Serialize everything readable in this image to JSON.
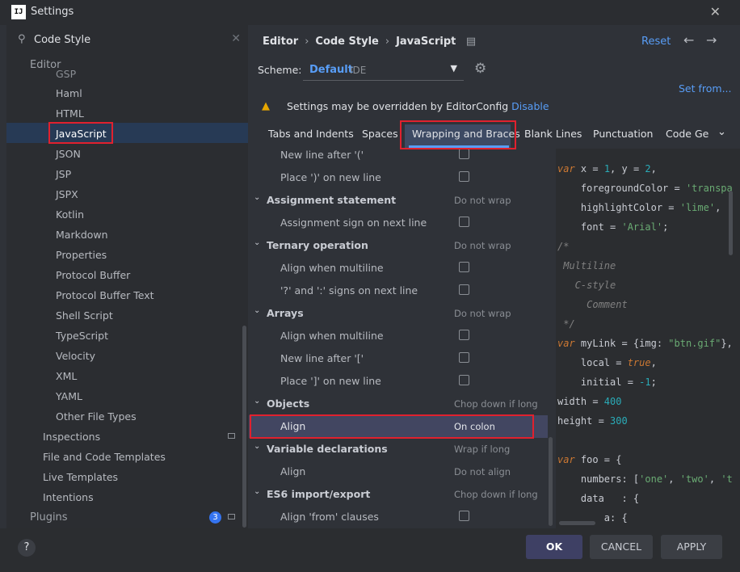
{
  "window": {
    "title": "Settings",
    "app_icon": "IJ"
  },
  "search": {
    "value": "Code Style"
  },
  "sidebar": {
    "section_editor": "Editor",
    "items": [
      "GSP",
      "Haml",
      "HTML",
      "JavaScript",
      "JSON",
      "JSP",
      "JSPX",
      "Kotlin",
      "Markdown",
      "Properties",
      "Protocol Buffer",
      "Protocol Buffer Text",
      "Shell Script",
      "TypeScript",
      "Velocity",
      "XML",
      "YAML",
      "Other File Types"
    ],
    "selected": "JavaScript",
    "editor_children": [
      "Inspections",
      "File and Code Templates",
      "Live Templates",
      "Intentions"
    ],
    "section_plugins": "Plugins",
    "plugins_badge": "3"
  },
  "breadcrumb": {
    "editor": "Editor",
    "code_style": "Code Style",
    "javascript": "JavaScript",
    "sep": "›"
  },
  "header": {
    "reset": "Reset"
  },
  "scheme": {
    "label": "Scheme:",
    "name": "Default",
    "type": "IDE"
  },
  "set_from": "Set from...",
  "warning": {
    "text": "Settings may be overridden by EditorConfig",
    "link": "Disable"
  },
  "tabs": [
    "Tabs and Indents",
    "Spaces",
    "Wrapping and Braces",
    "Blank Lines",
    "Punctuation",
    "Code Ge"
  ],
  "active_tab": "Wrapping and Braces",
  "options": [
    {
      "label": "New line after '('",
      "kind": "check"
    },
    {
      "label": "Place ')' on new line",
      "kind": "check"
    },
    {
      "label": "Assignment statement",
      "kind": "group",
      "value": "Do not wrap"
    },
    {
      "label": "Assignment sign on next line",
      "kind": "check"
    },
    {
      "label": "Ternary operation",
      "kind": "group",
      "value": "Do not wrap"
    },
    {
      "label": "Align when multiline",
      "kind": "check"
    },
    {
      "label": "'?' and ':' signs on next line",
      "kind": "check"
    },
    {
      "label": "Arrays",
      "kind": "group",
      "value": "Do not wrap"
    },
    {
      "label": "Align when multiline",
      "kind": "check"
    },
    {
      "label": "New line after '['",
      "kind": "check"
    },
    {
      "label": "Place ']' on new line",
      "kind": "check"
    },
    {
      "label": "Objects",
      "kind": "group",
      "value": "Chop down if long"
    },
    {
      "label": "Align",
      "kind": "value",
      "value": "On colon",
      "highlight": true
    },
    {
      "label": "Variable declarations",
      "kind": "group",
      "value": "Wrap if long"
    },
    {
      "label": "Align",
      "kind": "value",
      "value": "Do not align"
    },
    {
      "label": "ES6 import/export",
      "kind": "group",
      "value": "Chop down if long"
    },
    {
      "label": "Align 'from' clauses",
      "kind": "check"
    }
  ],
  "preview": [
    {
      "t": "empty"
    },
    {
      "t": "code",
      "parts": [
        [
          "kw",
          "var"
        ],
        [
          "p",
          " x = "
        ],
        [
          "num",
          "1"
        ],
        [
          "p",
          ", y = "
        ],
        [
          "num",
          "2"
        ],
        [
          "p",
          ","
        ]
      ]
    },
    {
      "t": "code",
      "parts": [
        [
          "p",
          "    foregroundColor = "
        ],
        [
          "str",
          "'transpa"
        ]
      ]
    },
    {
      "t": "code",
      "parts": [
        [
          "p",
          "    highlightColor = "
        ],
        [
          "str",
          "'lime'"
        ],
        [
          "p",
          ","
        ]
      ]
    },
    {
      "t": "code",
      "parts": [
        [
          "p",
          "    font = "
        ],
        [
          "str",
          "'Arial'"
        ],
        [
          "p",
          ";"
        ]
      ]
    },
    {
      "t": "code",
      "parts": [
        [
          "cmt",
          "/*"
        ]
      ]
    },
    {
      "t": "code",
      "parts": [
        [
          "cmt",
          " Multiline"
        ]
      ]
    },
    {
      "t": "code",
      "parts": [
        [
          "cmt",
          "   C-style"
        ]
      ]
    },
    {
      "t": "code",
      "parts": [
        [
          "cmt",
          "     Comment"
        ]
      ]
    },
    {
      "t": "code",
      "parts": [
        [
          "cmt",
          " */"
        ]
      ]
    },
    {
      "t": "code",
      "parts": [
        [
          "kw",
          "var"
        ],
        [
          "p",
          " myLink = {img: "
        ],
        [
          "str",
          "\"btn.gif\""
        ],
        [
          "p",
          "},"
        ]
      ]
    },
    {
      "t": "code",
      "parts": [
        [
          "p",
          "    local = "
        ],
        [
          "kw",
          "true"
        ],
        [
          "p",
          ","
        ]
      ]
    },
    {
      "t": "code",
      "parts": [
        [
          "p",
          "    initial = "
        ],
        [
          "num",
          "-1"
        ],
        [
          "p",
          ";"
        ]
      ]
    },
    {
      "t": "code",
      "parts": [
        [
          "p",
          "width = "
        ],
        [
          "num",
          "400"
        ]
      ]
    },
    {
      "t": "code",
      "parts": [
        [
          "p",
          "height = "
        ],
        [
          "num",
          "300"
        ]
      ]
    },
    {
      "t": "empty"
    },
    {
      "t": "code",
      "parts": [
        [
          "kw",
          "var"
        ],
        [
          "p",
          " foo = {"
        ]
      ]
    },
    {
      "t": "code",
      "parts": [
        [
          "p",
          "    numbers: ["
        ],
        [
          "str",
          "'one'"
        ],
        [
          "p",
          ", "
        ],
        [
          "str",
          "'two'"
        ],
        [
          "p",
          ", "
        ],
        [
          "str",
          "'t"
        ]
      ]
    },
    {
      "t": "code",
      "parts": [
        [
          "p",
          "    data   : {"
        ]
      ]
    },
    {
      "t": "code",
      "parts": [
        [
          "p",
          "        a: {"
        ]
      ]
    }
  ],
  "footer": {
    "help": "?",
    "ok": "OK",
    "cancel": "CANCEL",
    "apply": "APPLY"
  },
  "colors": {
    "accent": "#589df6",
    "highlight_box": "#e0212e",
    "selected_row": "#273a55"
  }
}
